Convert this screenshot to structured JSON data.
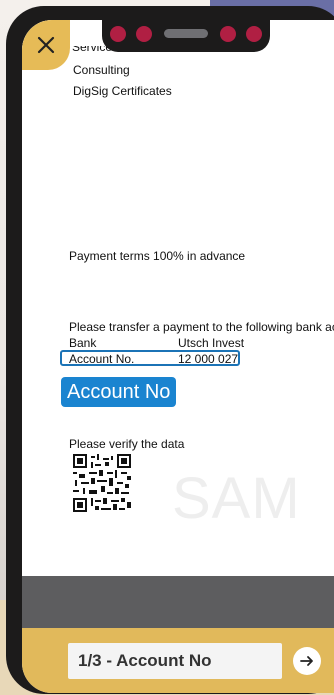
{
  "document": {
    "lines": {
      "service": "Service and Maintenance",
      "consulting": "Consulting",
      "digsig": "DigSig Certificates",
      "payment_terms": "Payment terms 100% in advance",
      "transfer": "Please transfer a payment to the following bank ac",
      "bank_label": "Bank",
      "bank_value": "Utsch Invest",
      "account_label": "Account No.",
      "account_value": "12 000 027",
      "verify": "Please verify the data"
    },
    "watermark": "SAM"
  },
  "field_badge": "Account No",
  "step": {
    "label": "1/3 - Account No"
  },
  "icons": {
    "close": "close-icon",
    "next": "arrow-right-icon",
    "qr": "qr-code-icon"
  },
  "colors": {
    "accent_gold": "#e1b95b",
    "highlight_blue": "#1a84d0"
  }
}
